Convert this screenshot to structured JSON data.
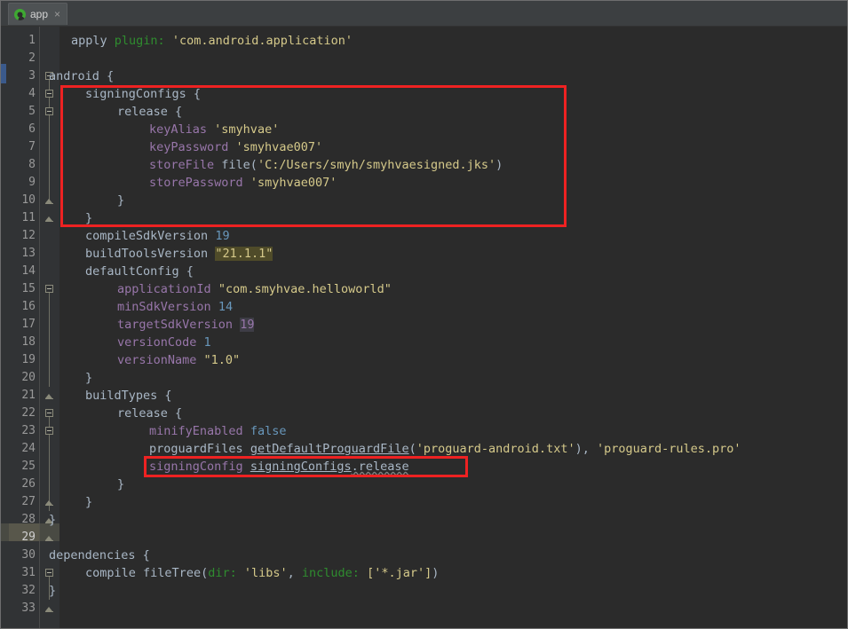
{
  "window": {
    "title": "app"
  },
  "tab": {
    "label": "app",
    "close_label": "×",
    "icon": "gradle-android-icon",
    "accent_color": "#3ea832"
  },
  "editor": {
    "background_color": "#2b2b2b",
    "gutter_color": "#313335",
    "current_line_number": 29,
    "total_lines": 33,
    "indent_guide_color": "#c8a24a",
    "annotation_color": "#ee2222",
    "line_numbers": [
      1,
      2,
      3,
      4,
      5,
      6,
      7,
      8,
      9,
      10,
      11,
      12,
      13,
      14,
      15,
      16,
      17,
      18,
      19,
      20,
      21,
      22,
      23,
      24,
      25,
      26,
      27,
      28,
      29,
      30,
      31,
      32,
      33
    ]
  },
  "code": {
    "lines": [
      {
        "n": 1,
        "text": "apply plugin: 'com.android.application'"
      },
      {
        "n": 2,
        "text": ""
      },
      {
        "n": 3,
        "text": "android {"
      },
      {
        "n": 4,
        "text": "    signingConfigs {"
      },
      {
        "n": 5,
        "text": "        release {"
      },
      {
        "n": 6,
        "text": "            keyAlias 'smyhvae'"
      },
      {
        "n": 7,
        "text": "            keyPassword 'smyhvae007'"
      },
      {
        "n": 8,
        "text": "            storeFile file('C:/Users/smyh/smyhvaesigned.jks')"
      },
      {
        "n": 9,
        "text": "            storePassword 'smyhvae007'"
      },
      {
        "n": 10,
        "text": "        }"
      },
      {
        "n": 11,
        "text": "    }"
      },
      {
        "n": 12,
        "text": "    compileSdkVersion 19"
      },
      {
        "n": 13,
        "text": "    buildToolsVersion \"21.1.1\""
      },
      {
        "n": 14,
        "text": "    defaultConfig {"
      },
      {
        "n": 15,
        "text": "        applicationId \"com.smyhvae.helloworld\""
      },
      {
        "n": 16,
        "text": "        minSdkVersion 14"
      },
      {
        "n": 17,
        "text": "        targetSdkVersion 19"
      },
      {
        "n": 18,
        "text": "        versionCode 1"
      },
      {
        "n": 19,
        "text": "        versionName \"1.0\""
      },
      {
        "n": 20,
        "text": "    }"
      },
      {
        "n": 21,
        "text": "    buildTypes {"
      },
      {
        "n": 22,
        "text": "        release {"
      },
      {
        "n": 23,
        "text": "            minifyEnabled false"
      },
      {
        "n": 24,
        "text": "            proguardFiles getDefaultProguardFile('proguard-android.txt'), 'proguard-rules.pro'"
      },
      {
        "n": 25,
        "text": "            signingConfig signingConfigs.release"
      },
      {
        "n": 26,
        "text": "        }"
      },
      {
        "n": 27,
        "text": "    }"
      },
      {
        "n": 28,
        "text": "}"
      },
      {
        "n": 29,
        "text": ""
      },
      {
        "n": 30,
        "text": "dependencies {"
      },
      {
        "n": 31,
        "text": "    compile fileTree(dir: 'libs', include: ['*.jar'])"
      },
      {
        "n": 32,
        "text": "}"
      },
      {
        "n": 33,
        "text": ""
      }
    ],
    "tokens": {
      "apply": "apply",
      "plugin": "plugin:",
      "plugin_value": "'com.android.application'",
      "android": "android {",
      "signingConfigs": "signingConfigs {",
      "release_open": "release {",
      "keyAlias": "keyAlias",
      "keyAlias_value": "'smyhvae'",
      "keyPassword": "keyPassword",
      "keyPassword_value": "'smyhvae007'",
      "storeFile": "storeFile",
      "storeFile_call": "file(",
      "storeFile_value": "'C:/Users/smyh/smyhvaesigned.jks'",
      "storeFile_close": ")",
      "storePassword": "storePassword",
      "storePassword_value": "'smyhvae007'",
      "compileSdkVersion": "compileSdkVersion",
      "compileSdkVersion_value": "19",
      "buildToolsVersion": "buildToolsVersion",
      "buildToolsVersion_value": "\"21.1.1\"",
      "defaultConfig": "defaultConfig {",
      "applicationId": "applicationId",
      "applicationId_value": "\"com.smyhvae.helloworld\"",
      "minSdkVersion": "minSdkVersion",
      "minSdkVersion_value": "14",
      "targetSdkVersion": "targetSdkVersion",
      "targetSdkVersion_value": "19",
      "versionCode": "versionCode",
      "versionCode_value": "1",
      "versionName": "versionName",
      "versionName_value": "\"1.0\"",
      "buildTypes": "buildTypes {",
      "minifyEnabled": "minifyEnabled",
      "minifyEnabled_value": "false",
      "proguardFiles": "proguardFiles",
      "getDefaultProguardFile": "getDefaultProguardFile",
      "proguard_open": "(",
      "proguard_android": "'proguard-android.txt'",
      "proguard_mid": "), ",
      "proguard_rules": "'proguard-rules.pro'",
      "signingConfig": "signingConfig",
      "signingConfigs_ref": "signingConfigs",
      "release_ref": ".release",
      "dependencies": "dependencies {",
      "compile": "compile",
      "fileTree": "fileTree(",
      "dir_param": "dir:",
      "libs_value": "'libs'",
      "comma": ", ",
      "include_param": "include:",
      "jar_value": "['*.jar']",
      "fileTree_close": ")",
      "brace_close": "}"
    }
  },
  "annotations": [
    {
      "name": "signing-configs-highlight",
      "label": "signingConfigs block"
    },
    {
      "name": "signing-config-line-highlight",
      "label": "signingConfig signingConfigs.release"
    }
  ]
}
